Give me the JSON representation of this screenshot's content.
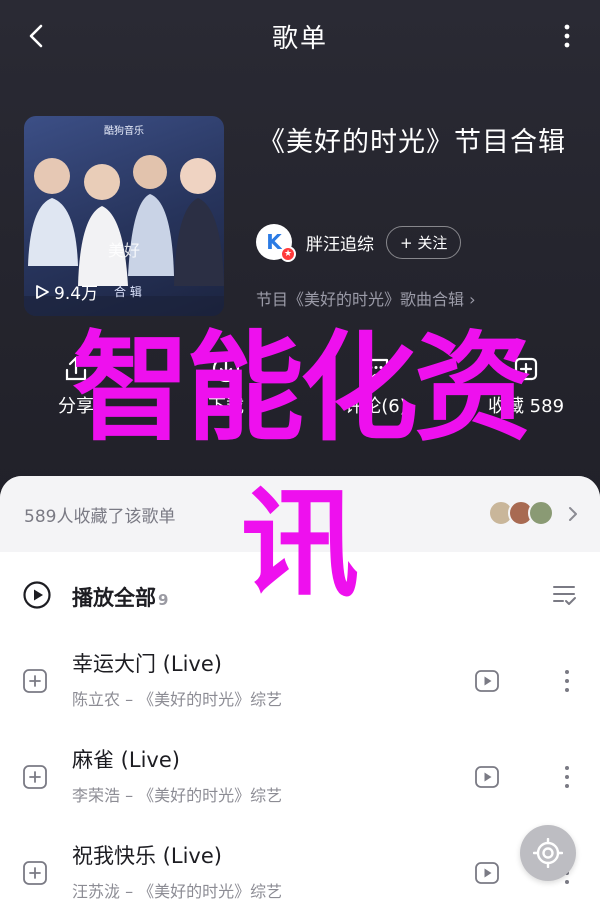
{
  "header": {
    "title": "歌单"
  },
  "playlist": {
    "cover_brand": "酷狗音乐",
    "play_count": "9.4万",
    "cover_caption": "合 辑",
    "title": "《美好的时光》节目合辑",
    "creator_name": "胖汪追综",
    "follow_label": "+ 关注",
    "tag_line": "节目《美好的时光》歌曲合辑",
    "tag_chevron": "›"
  },
  "actions": [
    {
      "label": "分享",
      "icon": "share-icon"
    },
    {
      "label": "下载",
      "icon": "download-icon"
    },
    {
      "label": "评论(6)",
      "icon": "comment-icon"
    },
    {
      "label": "收藏 589",
      "icon": "collect-icon"
    }
  ],
  "overlay": {
    "line1": "智能化资",
    "line2": "讯"
  },
  "collectors": {
    "text": "589人收藏了该歌单",
    "avatar_colors": [
      "#c9b69a",
      "#a86a52",
      "#8a9a74"
    ]
  },
  "playall": {
    "label": "播放全部",
    "count": "9"
  },
  "songs": [
    {
      "title": "幸运大门 (Live)",
      "subtitle": "陈立农 – 《美好的时光》综艺"
    },
    {
      "title": "麻雀 (Live)",
      "subtitle": "李荣浩 – 《美好的时光》综艺"
    },
    {
      "title": "祝我快乐 (Live)",
      "subtitle": "汪苏泷 – 《美好的时光》综艺"
    }
  ],
  "colors": {
    "hero_bg": "#25252e",
    "overlay_text": "#ee10ee",
    "muted_text": "#8c8c94"
  }
}
